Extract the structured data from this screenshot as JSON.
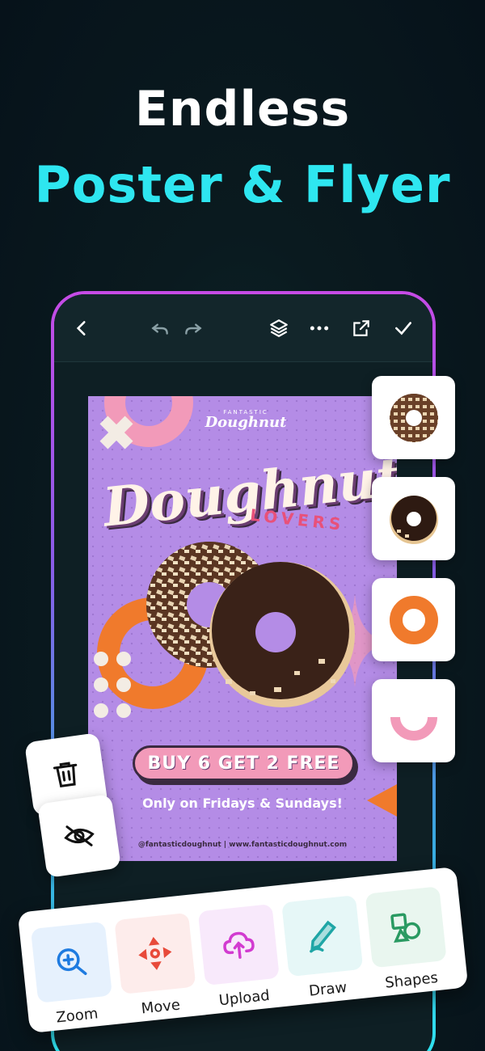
{
  "headline": {
    "line1": "Endless",
    "line2": "Poster & Flyer"
  },
  "colors": {
    "accent": "#2ee6f0",
    "phone_border_top": "#c64be6",
    "poster_bg": "#b48ce6",
    "deal_bg": "#f29ab9",
    "orange": "#f07a2c"
  },
  "toolbar": {
    "icons": [
      "back-icon",
      "undo-icon",
      "redo-icon",
      "layers-icon",
      "more-icon",
      "export-icon",
      "check-icon"
    ]
  },
  "poster": {
    "brand_top": "FANTASTIC",
    "brand": "Doughnut",
    "title": "Doughnut",
    "subtitle": "LOVERS",
    "deal": "BUY 6 GET 2 FREE",
    "deal_sub": "Only on Fridays & Sundays!",
    "footer": "@fantasticdoughnut | www.fantasticdoughnut.com"
  },
  "side_cards": [
    {
      "name": "nut-doughnut-thumbnail"
    },
    {
      "name": "chocolate-doughnut-thumbnail"
    },
    {
      "name": "orange-ring-thumbnail"
    },
    {
      "name": "pink-arc-thumbnail"
    }
  ],
  "floating_actions": {
    "delete_icon": "trash-icon",
    "hide_icon": "eye-off-icon"
  },
  "tools": [
    {
      "label": "Zoom",
      "icon": "zoom-icon",
      "bg": "#e6f1fd"
    },
    {
      "label": "Move",
      "icon": "move-icon",
      "bg": "#fdeceb"
    },
    {
      "label": "Upload",
      "icon": "upload-icon",
      "bg": "#f8e9fb"
    },
    {
      "label": "Draw",
      "icon": "draw-icon",
      "bg": "#e6f7f7"
    },
    {
      "label": "Shapes",
      "icon": "shapes-icon",
      "bg": "#e9f6ef"
    }
  ]
}
